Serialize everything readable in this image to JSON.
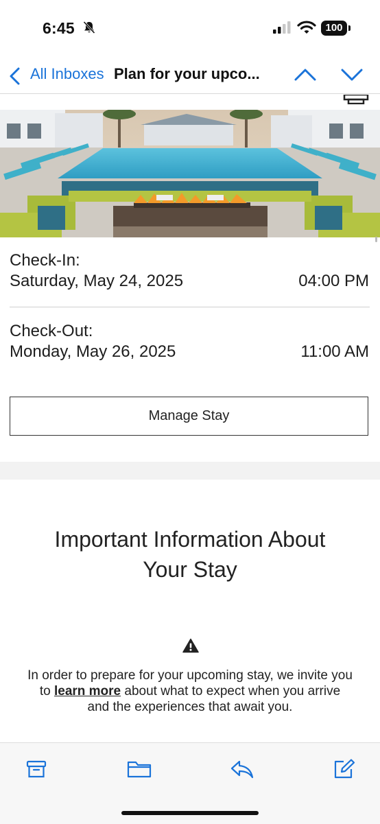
{
  "status_bar": {
    "time": "6:45",
    "battery": "100",
    "icons": [
      "bell-slash-icon",
      "cellular-signal-icon",
      "wifi-icon",
      "battery-icon"
    ]
  },
  "nav": {
    "back_label": "All Inboxes",
    "subject": "Plan for your upco...",
    "icons": [
      "chevron-left-icon",
      "chevron-up-icon",
      "chevron-down-icon"
    ],
    "accent_color": "#1a73d9"
  },
  "stay": {
    "checkin_label": "Check-In:",
    "checkin_date": "Saturday, May 24, 2025",
    "checkin_time": "04:00 PM",
    "checkout_label": "Check-Out:",
    "checkout_date": "Monday, May 26, 2025",
    "checkout_time": "11:00 AM",
    "manage_button": "Manage Stay"
  },
  "info": {
    "heading_line1": "Important Information About",
    "heading_line2": "Your Stay",
    "para_before": "In order to prepare for your upcoming stay, we invite you to ",
    "para_link": "learn more",
    "para_after": " about what to expect when you arrive and the experiences that await you."
  },
  "toolbar": {
    "icons": [
      "archive-icon",
      "folder-icon",
      "reply-icon",
      "compose-icon"
    ],
    "color": "#1a73d9"
  }
}
